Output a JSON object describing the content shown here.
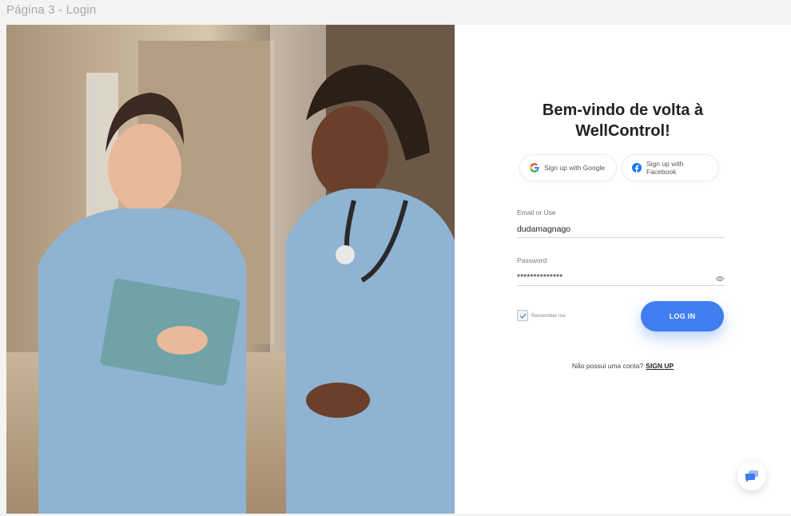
{
  "frame_label": "Página 3 - Login",
  "login": {
    "title_line1": "Bem-vindo de volta à",
    "title_line2": "WellControl!",
    "google_label": "Sign up with Google",
    "facebook_label": "Sign up with Facebook",
    "email_label": "Email or Use",
    "email_value": "dudamagnago",
    "password_label": "Password",
    "password_value": "**************",
    "remember_label": "Remember me",
    "login_button": "LOG IN",
    "no_account_text": "Não possui uma conta?",
    "signup_link": "SIGN UP"
  },
  "colors": {
    "accent": "#3f7df1",
    "scrubs": "#8fb3d2",
    "background": "#ffffff"
  },
  "icons": {
    "google": "google-icon",
    "facebook": "facebook-icon",
    "eye": "eye-icon",
    "check": "check-icon",
    "chat": "chat-icon"
  }
}
